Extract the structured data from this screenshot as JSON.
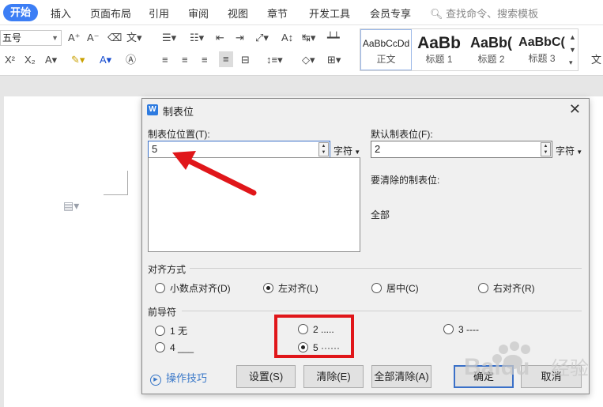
{
  "ribbon": {
    "tabs": [
      "开始",
      "插入",
      "页面布局",
      "引用",
      "审阅",
      "视图",
      "章节",
      "开发工具",
      "会员专享"
    ],
    "search_label": "查找命令、搜索模板",
    "font_size": "五号",
    "styles": [
      {
        "sample": "AaBbCcDd",
        "name": "正文"
      },
      {
        "sample": "AaBb",
        "name": "标题 1"
      },
      {
        "sample": "AaBb(",
        "name": "标题 2"
      },
      {
        "sample": "AaBbC(",
        "name": "标题 3"
      }
    ],
    "right_cut_label": "文"
  },
  "dialog": {
    "title": "制表位",
    "tab_pos_label": "制表位位置(T):",
    "tab_pos_value": "5",
    "tab_pos_unit": "字符",
    "default_label": "默认制表位(F):",
    "default_value": "2",
    "default_unit": "字符",
    "clear_label": "要清除的制表位:",
    "clear_value": "全部",
    "align_title": "对齐方式",
    "align_options": [
      {
        "label": "小数点对齐(D)",
        "checked": false
      },
      {
        "label": "左对齐(L)",
        "checked": true
      },
      {
        "label": "居中(C)",
        "checked": false
      },
      {
        "label": "右对齐(R)",
        "checked": false
      }
    ],
    "leader_title": "前导符",
    "leader_options": [
      {
        "label": "1 无",
        "checked": false
      },
      {
        "label": "2 .....",
        "checked": false
      },
      {
        "label": "3 ----",
        "checked": false
      },
      {
        "label": "4 ___",
        "checked": false
      },
      {
        "label": "5 ······",
        "checked": true
      }
    ],
    "tips_label": "操作技巧",
    "buttons": {
      "set": "设置(S)",
      "clear": "清除(E)",
      "clear_all": "全部清除(A)",
      "ok": "确定",
      "cancel": "取消"
    }
  },
  "watermark": {
    "brand": "Baidu",
    "sub": "经验"
  },
  "colors": {
    "accent": "#3c7ef5",
    "annotation": "#e0161a",
    "link": "#3a78c8"
  }
}
